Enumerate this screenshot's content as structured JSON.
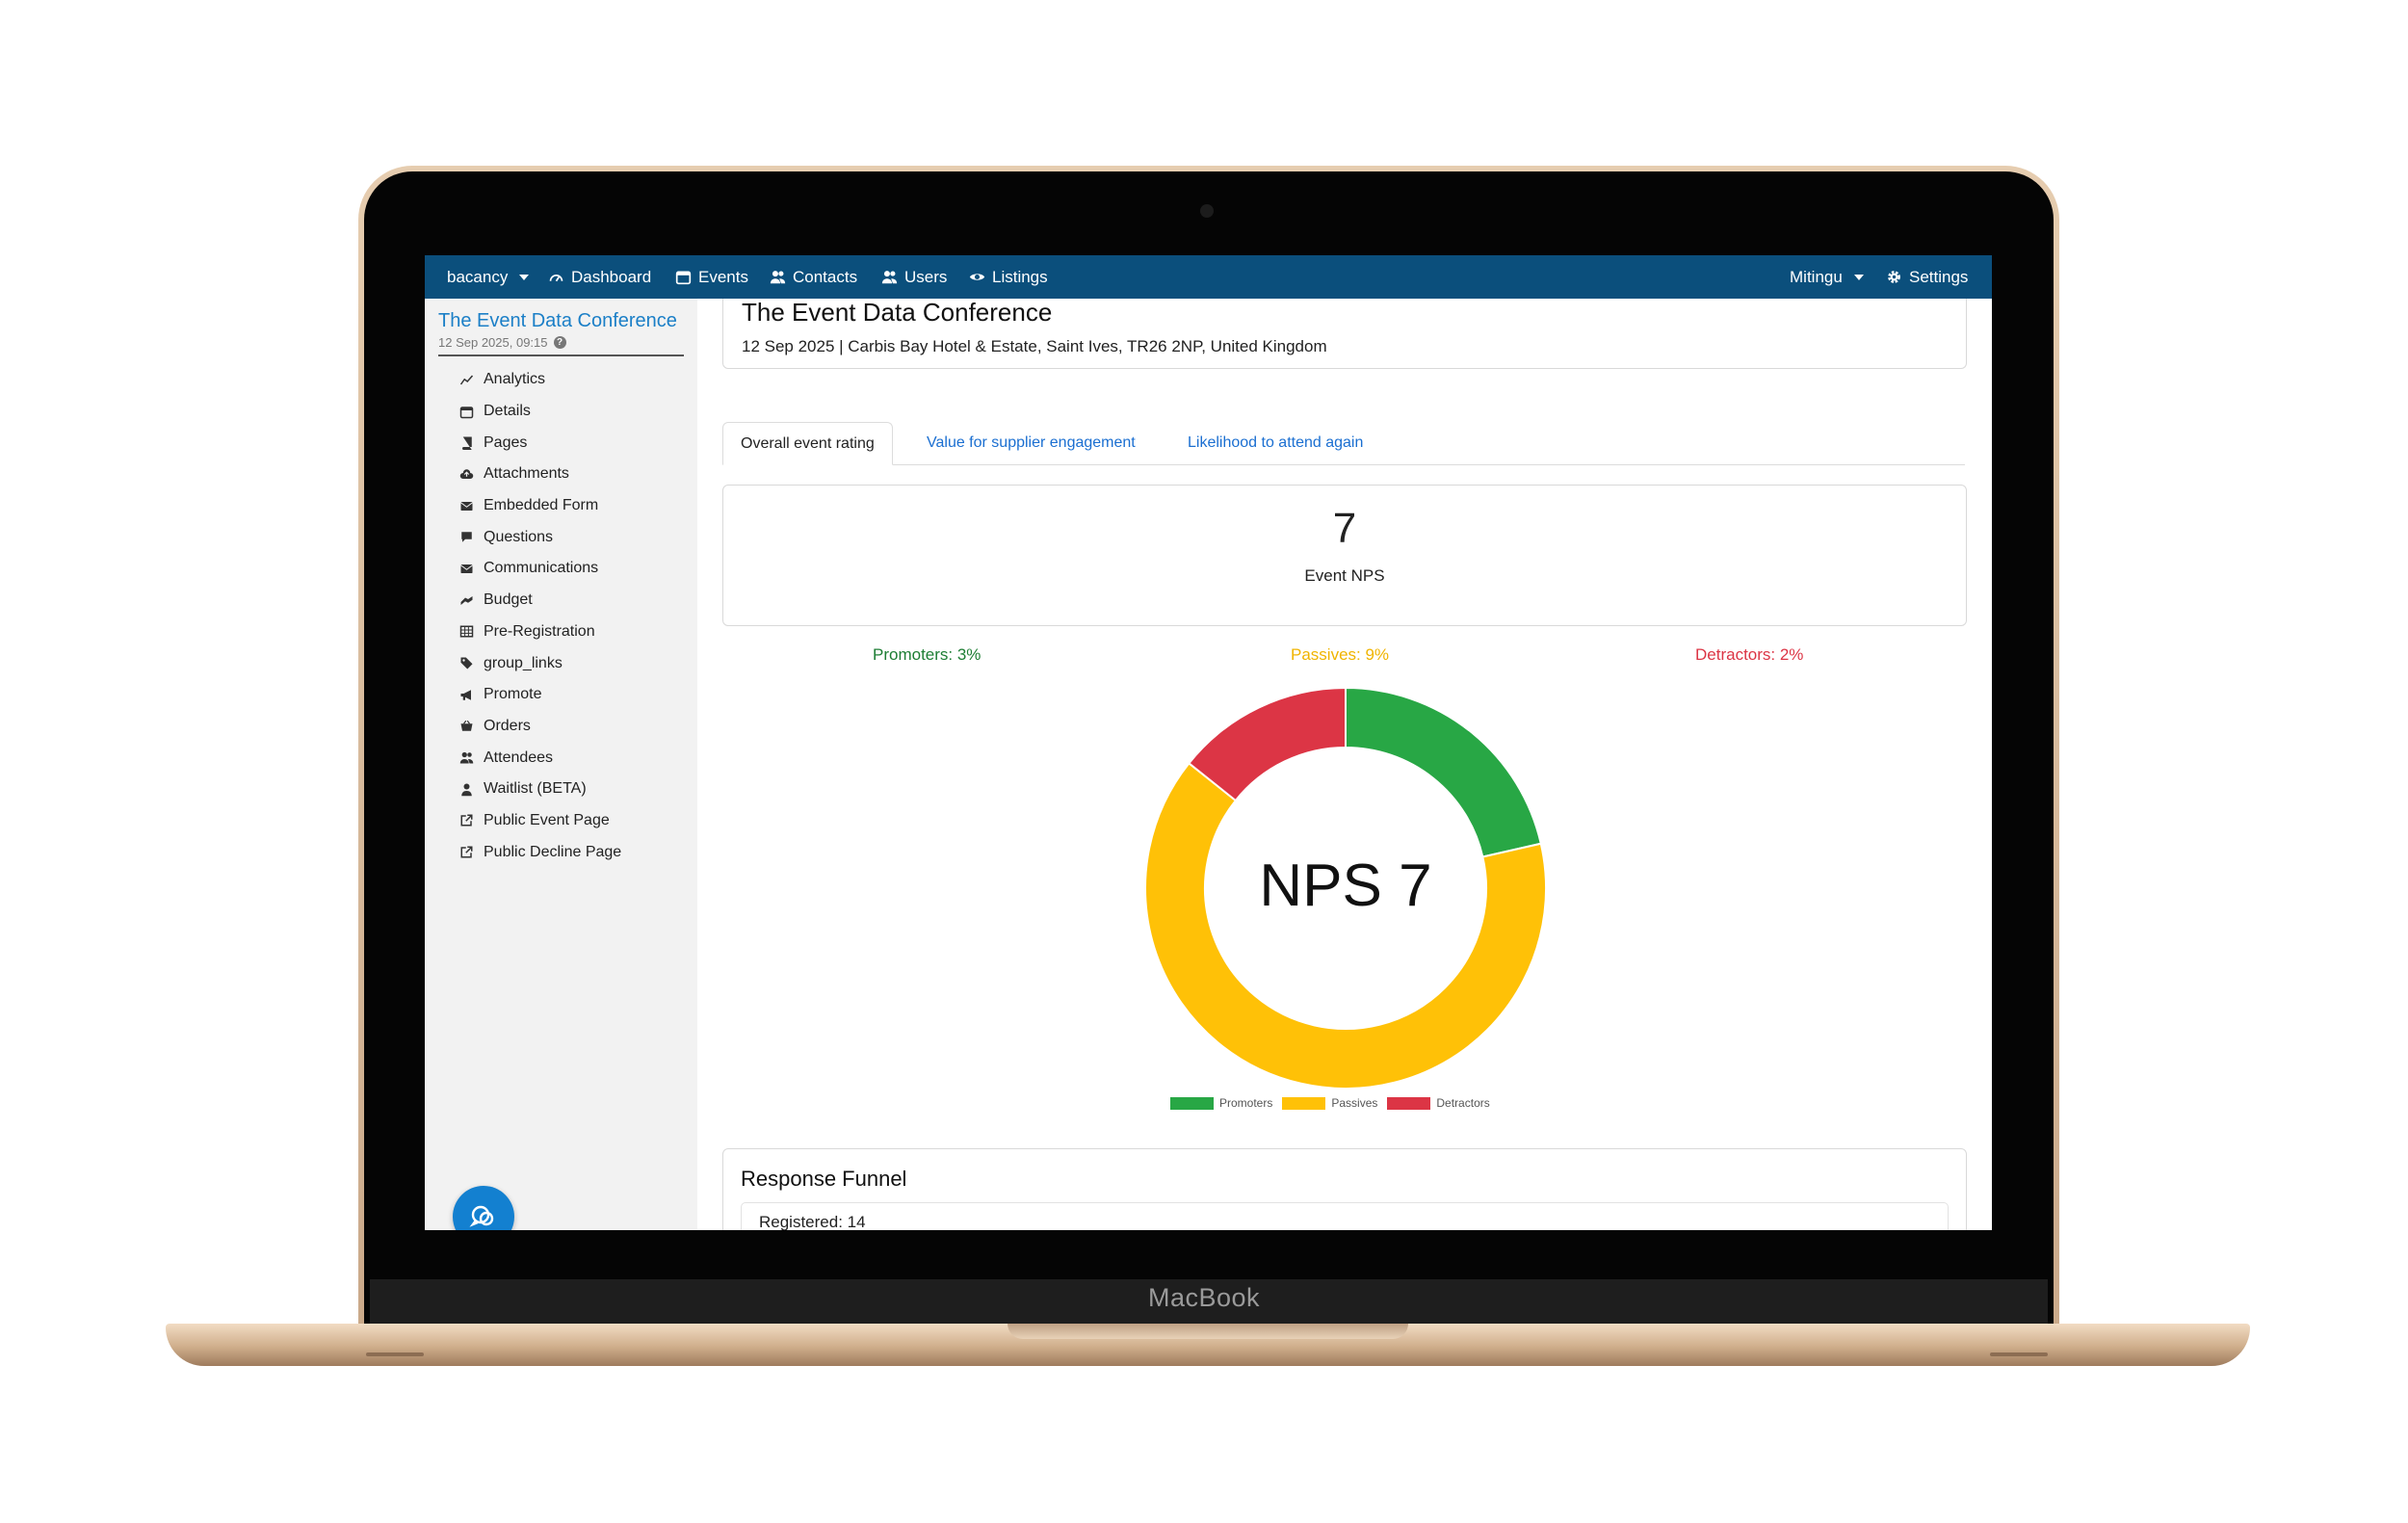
{
  "device": {
    "brand": "MacBook"
  },
  "topnav": {
    "org": "bacancy",
    "items": [
      {
        "label": "Dashboard",
        "icon": "gauge-icon"
      },
      {
        "label": "Events",
        "icon": "calendar-icon"
      },
      {
        "label": "Contacts",
        "icon": "users-icon"
      },
      {
        "label": "Users",
        "icon": "users-icon"
      },
      {
        "label": "Listings",
        "icon": "eye-icon"
      }
    ],
    "account": "Mitingu",
    "settings": "Settings"
  },
  "sidebar": {
    "event_title": "The Event Data Conference",
    "event_date": "12 Sep 2025, 09:15",
    "items": [
      {
        "label": "Analytics",
        "icon": "chart-line-icon"
      },
      {
        "label": "Details",
        "icon": "calendar-icon"
      },
      {
        "label": "Pages",
        "icon": "book-icon"
      },
      {
        "label": "Attachments",
        "icon": "cloud-upload-icon"
      },
      {
        "label": "Embedded Form",
        "icon": "envelope-icon"
      },
      {
        "label": "Questions",
        "icon": "comment-icon"
      },
      {
        "label": "Communications",
        "icon": "envelope-icon"
      },
      {
        "label": "Budget",
        "icon": "money-icon"
      },
      {
        "label": "Pre-Registration",
        "icon": "table-icon"
      },
      {
        "label": "group_links",
        "icon": "ticket-icon"
      },
      {
        "label": "Promote",
        "icon": "bullhorn-icon"
      },
      {
        "label": "Orders",
        "icon": "basket-icon"
      },
      {
        "label": "Attendees",
        "icon": "users-icon"
      },
      {
        "label": "Waitlist (BETA)",
        "icon": "user-icon"
      },
      {
        "label": "Public Event Page",
        "icon": "external-link-icon"
      },
      {
        "label": "Public Decline Page",
        "icon": "external-link-icon"
      }
    ]
  },
  "header": {
    "title": "The Event Data Conference",
    "subtitle": "12 Sep 2025 | Carbis Bay Hotel & Estate, Saint Ives, TR26 2NP, United Kingdom"
  },
  "tabs": [
    {
      "label": "Overall event rating",
      "active": true
    },
    {
      "label": "Value for supplier engagement",
      "active": false
    },
    {
      "label": "Likelihood to attend again",
      "active": false
    }
  ],
  "nps": {
    "value": "7",
    "label": "Event NPS"
  },
  "categories": {
    "promoters": "Promoters: 3%",
    "passives": "Passives: 9%",
    "detractors": "Detractors: 2%"
  },
  "colors": {
    "promoters": "#28a745",
    "passives": "#ffc107",
    "detractors": "#dc3545",
    "nav": "#0b4f7c",
    "link": "#1b6fd1"
  },
  "chart_data": {
    "type": "pie",
    "center_text": "NPS 7",
    "categories": [
      "Promoters",
      "Passives",
      "Detractors"
    ],
    "values": [
      3,
      9,
      2
    ],
    "colors": [
      "#28a745",
      "#ffc107",
      "#dc3545"
    ],
    "legend": "bottom"
  },
  "funnel": {
    "title": "Response Funnel",
    "rows": [
      "Registered: 14"
    ]
  }
}
